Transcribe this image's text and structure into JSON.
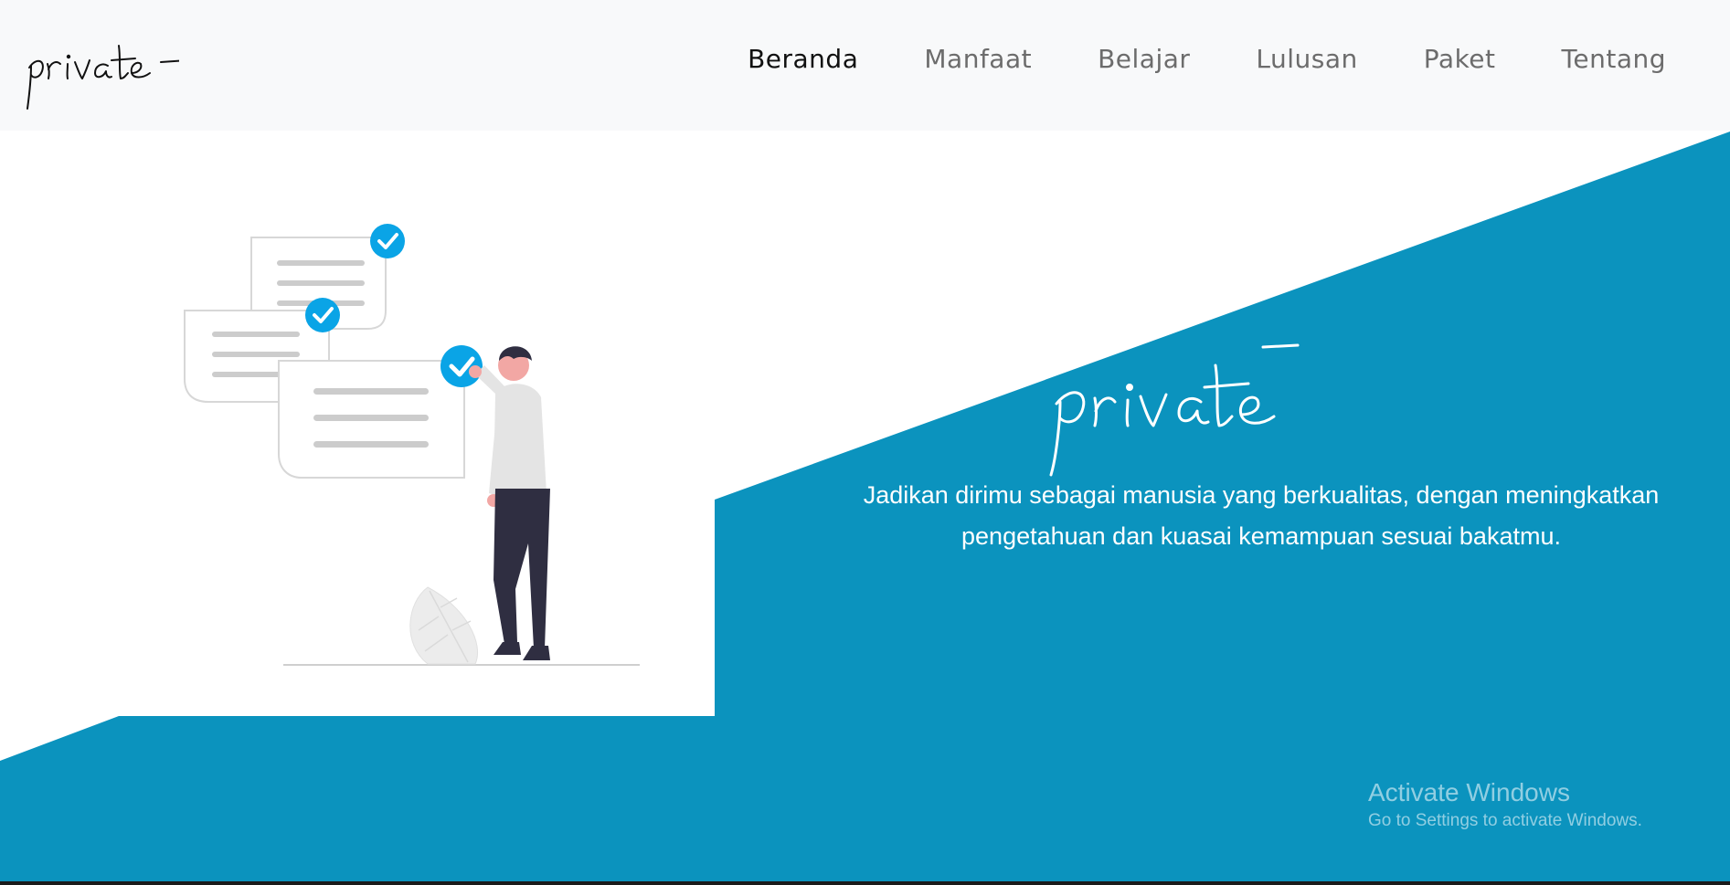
{
  "brand": {
    "logo_text": "private"
  },
  "nav": {
    "items": [
      {
        "label": "Beranda",
        "active": true
      },
      {
        "label": "Manfaat",
        "active": false
      },
      {
        "label": "Belajar",
        "active": false
      },
      {
        "label": "Lulusan",
        "active": false
      },
      {
        "label": "Paket",
        "active": false
      },
      {
        "label": "Tentang",
        "active": false
      }
    ]
  },
  "hero": {
    "title": "private",
    "line1": "Jadikan dirimu sebagai manusia yang berkualitas, dengan meningkatkan",
    "line2": "pengetahuan dan kuasai kemampuan sesuai bakatmu."
  },
  "watermark": {
    "title": "Activate Windows",
    "subtitle": "Go to Settings to activate Windows."
  },
  "colors": {
    "navbar_bg": "#f8f9fa",
    "hero_accent": "#0b93be",
    "check_blue": "#0aa4e6",
    "nav_active": "#111111",
    "nav_inactive": "#6c6c6c"
  },
  "icons": {
    "check": "check-circle-icon"
  }
}
